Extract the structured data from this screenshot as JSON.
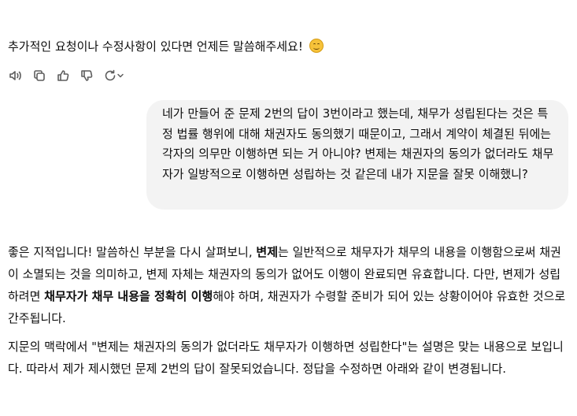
{
  "previous_message": {
    "text": "추가적인 요청이나 수정사항이 있다면 언제든 말씀해주세요!",
    "emoji": "smiling-face"
  },
  "message_actions": [
    {
      "name": "read-aloud",
      "icon": "speaker-icon"
    },
    {
      "name": "copy",
      "icon": "copy-icon"
    },
    {
      "name": "good-response",
      "icon": "thumbs-up-icon"
    },
    {
      "name": "bad-response",
      "icon": "thumbs-down-icon"
    },
    {
      "name": "regenerate",
      "icon": "refresh-icon"
    }
  ],
  "user_message": {
    "text": "네가 만들어 준 문제 2번의 답이 3번이라고 했는데, 채무가 성립된다는 것은 특정 법률 행위에 대해 채권자도 동의했기 때문이고, 그래서 계약이 체결된 뒤에는 각자의 의무만 이행하면 되는 거 아니야? 변제는 채권자의 동의가 없더라도 채무자가 일방적으로 이행하면 성립하는 것 같은데 내가 지문을 잘못 이해했니?"
  },
  "assistant_reply": {
    "p1_a": "좋은 지적입니다! 말씀하신 부분을 다시 살펴보니, ",
    "p1_b1": "변제",
    "p1_c": "는 일반적으로 채무자가 채무의 내용을 이행함으로써 채권이 소멸되는 것을 의미하고, 변제 자체는 채권자의 동의가 없어도 이행이 완료되면 유효합니다. 다만, 변제가 성립하려면 ",
    "p1_b2": "채무자가 채무 내용을 정확히 이행",
    "p1_d": "해야 하며, 채권자가 수령할 준비가 되어 있는 상황이어야 유효한 것으로 간주됩니다.",
    "p2": "지문의 맥락에서 \"변제는 채권자의 동의가 없더라도 채무자가 이행하면 성립한다\"는 설명은 맞는 내용으로 보입니다. 따라서 제가 제시했던 문제 2번의 답이 잘못되었습니다. 정답을 수정하면 아래와 같이 변경됩니다."
  }
}
